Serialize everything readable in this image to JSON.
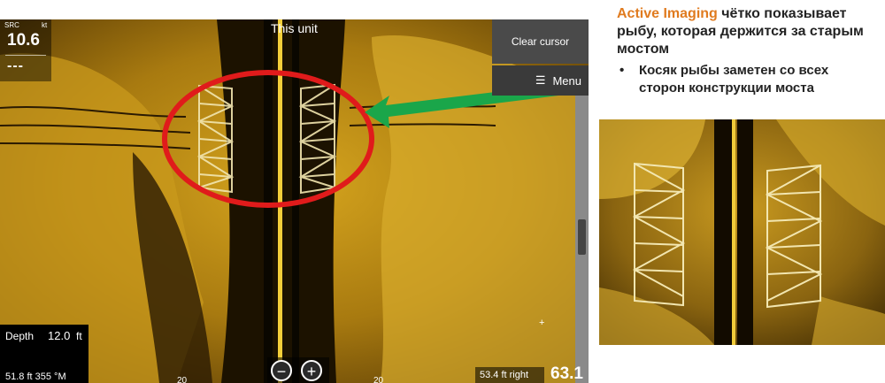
{
  "sonar": {
    "speed": {
      "label": "SRC",
      "unit": "kt",
      "value": "10.6",
      "secondary": "---"
    },
    "source_label": "This unit",
    "clear_cursor_label": "Clear cursor",
    "menu_label": "Menu",
    "depth": {
      "label": "Depth",
      "value": "12.0",
      "unit": "ft"
    },
    "position_text": "51.8 ft  355 °M",
    "zoom_out_symbol": "−",
    "zoom_in_symbol": "+",
    "scale_left": "20",
    "scale_right": "20",
    "range_text": "53.4 ft right",
    "frequency_text": "63.1",
    "crosshair_symbol": "+",
    "colors": {
      "sonar_bright": "#e2b42a",
      "sonar_dark": "#1a1000",
      "callout_ring": "#e01b1b",
      "pointer_arrow": "#1aa64a"
    }
  },
  "caption": {
    "brand": "Active Imaging",
    "headline_rest": " чётко показывает рыбу, которая держится за старым мостом",
    "bullet_symbol": "•",
    "bullet_text": "Косяк рыбы заметен со всех сторон конструкции моста",
    "brand_color": "#e07b1f"
  }
}
